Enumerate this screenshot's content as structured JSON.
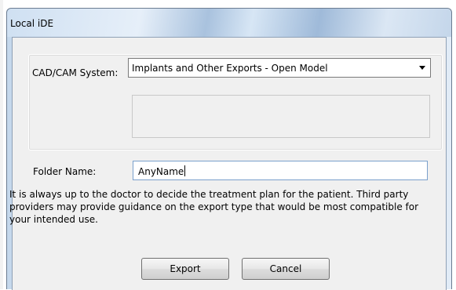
{
  "window": {
    "title": "Local iDE"
  },
  "cad_cam": {
    "label": "CAD/CAM System:",
    "selected": "Implants and Other Exports - Open Model"
  },
  "folder": {
    "label": "Folder Name:",
    "value": "AnyName"
  },
  "note": "It is always up to the doctor to decide the treatment plan for the patient. Third party providers may provide guidance on the export type that would be most compatible for your intended use.",
  "buttons": {
    "export_label": "Export",
    "cancel_label": "Cancel"
  },
  "colors": {
    "dialog_bg": "#f0f0f0",
    "titlebar": "#c5d8ec",
    "focus_border": "#7aa0cc"
  },
  "icons": {
    "dropdown": "chevron-down-icon"
  }
}
